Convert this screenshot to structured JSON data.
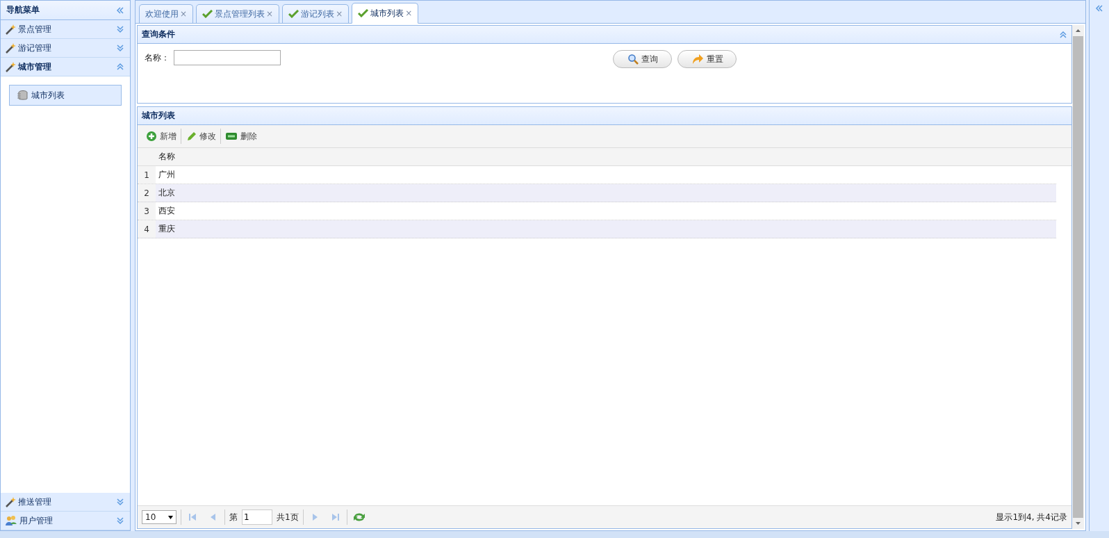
{
  "sidebar": {
    "title": "导航菜单",
    "sections": [
      {
        "label": "景点管理",
        "kind": "wand",
        "expanded": false
      },
      {
        "label": "游记管理",
        "kind": "wand",
        "expanded": false
      },
      {
        "label": "城市管理",
        "kind": "wand",
        "expanded": true,
        "items": [
          {
            "label": "城市列表",
            "selected": true
          }
        ]
      },
      {
        "label": "推送管理",
        "kind": "wand",
        "expanded": false
      },
      {
        "label": "用户管理",
        "kind": "users",
        "expanded": false
      }
    ]
  },
  "tabs": [
    {
      "label": "欢迎使用",
      "kind": "plain",
      "close": "×",
      "selected": false
    },
    {
      "label": "景点管理列表",
      "kind": "check",
      "close": "×",
      "selected": false
    },
    {
      "label": "游记列表",
      "kind": "check",
      "close": "×",
      "selected": false
    },
    {
      "label": "城市列表",
      "kind": "check",
      "close": "×",
      "selected": true
    }
  ],
  "query": {
    "title": "查询条件",
    "field_label": "名称：",
    "buttons": [
      {
        "label": "查询",
        "kind": "search"
      },
      {
        "label": "重置",
        "kind": "reset"
      }
    ]
  },
  "grid": {
    "title": "城市列表",
    "toolbar": [
      {
        "label": "新增",
        "kind": "add"
      },
      {
        "label": "修改",
        "kind": "edit"
      },
      {
        "label": "删除",
        "kind": "remove"
      }
    ],
    "columns": [
      "名称"
    ],
    "rows": [
      {
        "number": "1",
        "name": "广州"
      },
      {
        "number": "2",
        "name": "北京"
      },
      {
        "number": "3",
        "name": "西安"
      },
      {
        "number": "4",
        "name": "重庆"
      }
    ],
    "pager": {
      "page_size": "10",
      "page_prefix": "第",
      "page": "1",
      "total_pages": "共1页",
      "summary": "显示1到4, 共4记录"
    }
  }
}
